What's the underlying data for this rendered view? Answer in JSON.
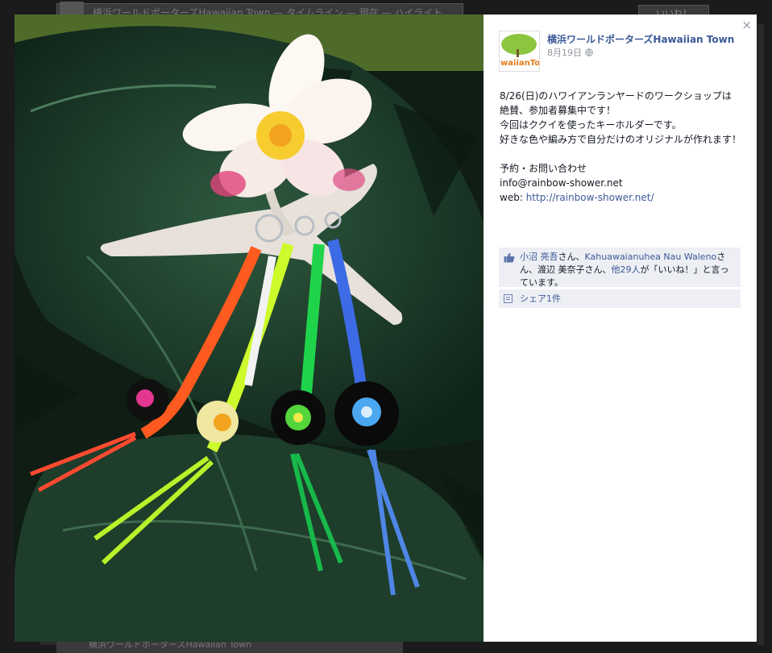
{
  "background": {
    "top_bar_text": "横浜ワールドポーターズHawaiian Town — タイムライン — 現在 — ハイライト",
    "like_button_label": "いいね！",
    "bottom_text": "横浜ワールドポーターズHawaiian Town"
  },
  "lightbox": {
    "close_label": "×",
    "page": {
      "name": "横浜ワールドポーターズHawaiian Town",
      "logo_text": "waiianTo"
    },
    "post": {
      "date": "8月19日",
      "lines": [
        "8/26(日)のハワイアンランヤードのワークショップは",
        "絶賛、参加者募集中です！",
        "今回はククイを使ったキーホルダーです。",
        "好きな色や編み方で自分だけのオリジナルが作れます！"
      ],
      "contact_heading": "予約・お問い合わせ",
      "email": "info@rainbow-shower.net",
      "web_label": "web: ",
      "web_url": "http://rainbow-shower.net/"
    },
    "likes": {
      "user1": "小沼 亮吾",
      "san1": "さん、",
      "user2": "Kahuawaianuhea Nau Waleno",
      "san2": "さん、渡辺 美奈子さん、",
      "others": "他29人",
      "suffix": "が「いいね！」と言っています。"
    },
    "share_label": "シェア1件"
  },
  "colors": {
    "link": "#3b5998",
    "panel_bg": "#edeff4",
    "overlay": "#1b1b1b"
  }
}
